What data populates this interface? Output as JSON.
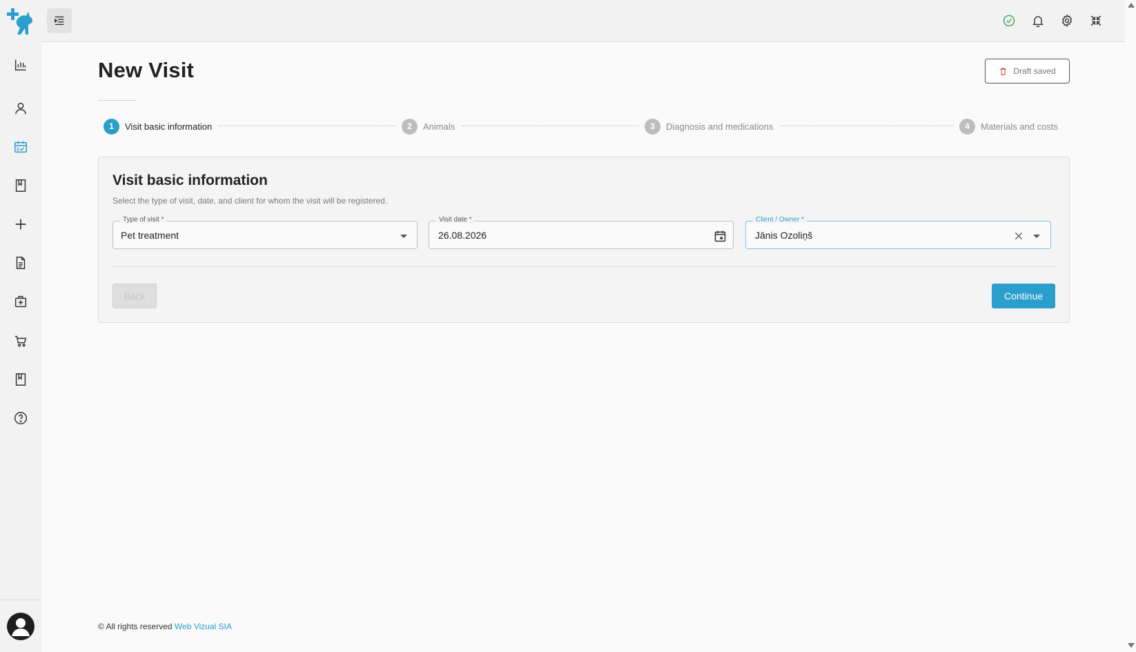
{
  "app": {
    "brand_color": "#2a9fcc"
  },
  "sidebar": {
    "items": [
      {
        "icon": "bar-chart-icon",
        "name": "sidebar-item-statistics"
      },
      {
        "icon": "user-icon",
        "name": "sidebar-item-clients"
      },
      {
        "icon": "calendar-check-icon",
        "name": "sidebar-item-visits",
        "active": true
      },
      {
        "icon": "bookmark-icon",
        "name": "sidebar-item-bookmarks"
      },
      {
        "icon": "plus-icon",
        "name": "sidebar-item-add"
      },
      {
        "icon": "document-icon",
        "name": "sidebar-item-documents"
      },
      {
        "icon": "medical-kit-icon",
        "name": "sidebar-item-medical"
      },
      {
        "icon": "cart-icon",
        "name": "sidebar-item-shop"
      },
      {
        "icon": "book-icon",
        "name": "sidebar-item-catalog"
      },
      {
        "icon": "help-icon",
        "name": "sidebar-item-help"
      }
    ]
  },
  "header": {
    "title": "New Visit",
    "draft_label": "Draft saved"
  },
  "stepper": {
    "steps": [
      {
        "number": "1",
        "label": "Visit basic information",
        "active": true
      },
      {
        "number": "2",
        "label": "Animals",
        "active": false
      },
      {
        "number": "3",
        "label": "Diagnosis and medications",
        "active": false
      },
      {
        "number": "4",
        "label": "Materials and costs",
        "active": false
      }
    ]
  },
  "form": {
    "title": "Visit basic information",
    "subtitle": "Select the type of visit, date, and client for whom the visit will be registered.",
    "type_of_visit": {
      "label": "Type of visit *",
      "value": "Pet treatment"
    },
    "visit_date": {
      "label": "Visit date *",
      "value": "26.08.2026"
    },
    "client": {
      "label": "Client / Owner *",
      "value": "Jānis Ozoliņš"
    },
    "back_label": "Back",
    "continue_label": "Continue"
  },
  "footer": {
    "text": "© All rights reserved",
    "link": "Web Vizual SIA"
  }
}
